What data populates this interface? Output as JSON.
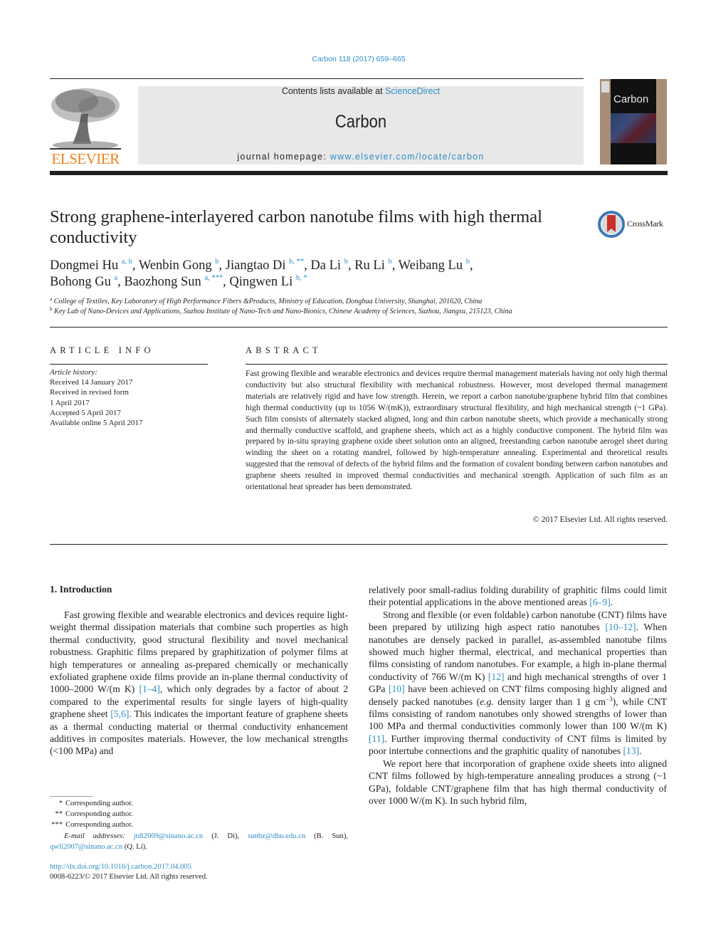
{
  "citation": "Carbon 118 (2017) 659–665",
  "header": {
    "publisher_logo_text": "ELSEVIER",
    "contents_prefix": "Contents lists available at ",
    "contents_link": "ScienceDirect",
    "journal_name": "Carbon",
    "homepage_prefix": "journal homepage: ",
    "homepage_link": "www.elsevier.com/locate/carbon",
    "cover_title": "Carbon"
  },
  "article": {
    "title": "Strong graphene-interlayered carbon nanotube films with high thermal conductivity",
    "crossmark_label": "CrossMark",
    "authors": [
      {
        "name": "Dongmei Hu",
        "marks": "a, b"
      },
      {
        "name": "Wenbin Gong",
        "marks": "b"
      },
      {
        "name": "Jiangtao Di",
        "marks": "b, **"
      },
      {
        "name": "Da Li",
        "marks": "b"
      },
      {
        "name": "Ru Li",
        "marks": "b"
      },
      {
        "name": "Weibang Lu",
        "marks": "b"
      },
      {
        "name": "Bohong Gu",
        "marks": "a"
      },
      {
        "name": "Baozhong Sun",
        "marks": "a, ***"
      },
      {
        "name": "Qingwen Li",
        "marks": "b, *"
      }
    ],
    "affiliations": [
      {
        "mark": "a",
        "text": "College of Textiles, Key Laboratory of High Performance Fibers &Products, Ministry of Education, Donghua University, Shanghai, 201620, China"
      },
      {
        "mark": "b",
        "text": "Key Lab of Nano-Devices and Applications, Suzhou Institute of Nano-Tech and Nano-Bionics, Chinese Academy of Sciences, Suzhou, Jiangsu, 215123, China"
      }
    ]
  },
  "article_info": {
    "heading": "ARTICLE INFO",
    "history_label": "Article history:",
    "history": [
      "Received 14 January 2017",
      "Received in revised form",
      "1 April 2017",
      "Accepted 5 April 2017",
      "Available online 5 April 2017"
    ]
  },
  "abstract": {
    "heading": "ABSTRACT",
    "text": "Fast growing flexible and wearable electronics and devices require thermal management materials having not only high thermal conductivity but also structural flexibility with mechanical robustness. However, most developed thermal management materials are relatively rigid and have low strength. Herein, we report a carbon nanotube/graphene hybrid film that combines high thermal conductivity (up to 1056 W/(mK)), extraordinary structural flexibility, and high mechanical strength (~1 GPa). Such film consists of alternately stacked aligned, long and thin carbon nanotube sheets, which provide a mechanically strong and thermally conductive scaffold, and graphene sheets, which act as a highly conductive component. The hybrid film was prepared by in-situ spraying graphene oxide sheet solution onto an aligned, freestanding carbon nanotube aerogel sheet during winding the sheet on a rotating mandrel, followed by high-temperature annealing. Experimental and theoretical results suggested that the removal of defects of the hybrid films and the formation of covalent bonding between carbon nanotubes and graphene sheets resulted in improved thermal conductivities and mechanical strength. Application of such film as an orientational heat spreader has been demonstrated.",
    "copyright": "© 2017 Elsevier Ltd. All rights reserved."
  },
  "body": {
    "section_heading": "1.  Introduction",
    "left_p1": [
      {
        "t": "Fast growing flexible and wearable electronics and devices require light-weight thermal dissipation materials that combine such properties as high thermal conductivity, good structural flexibility and novel mechanical robustness. Graphitic films prepared by graphitization of polymer films at high temperatures or annealing as-prepared chemically or mechanically exfoliated graphene oxide films provide an in-plane thermal conductivity of 1000–2000 W/(m K) "
      },
      {
        "ref": "[1–4]"
      },
      {
        "t": ", which only degrades by a factor of about 2 compared to the experimental results for single layers of high-quality graphene sheet "
      },
      {
        "ref": "[5,6]"
      },
      {
        "t": ". This indicates the important feature of graphene sheets as a thermal conducting material or thermal conductivity enhancement additives in composites materials. However, the low mechanical strengths (<100 MPa) and"
      }
    ],
    "right_p1": [
      {
        "t": "relatively poor small-radius folding durability of graphitic films could limit their potential applications in the above mentioned areas "
      },
      {
        "ref": "[6–9]"
      },
      {
        "t": "."
      }
    ],
    "right_p2": [
      {
        "t": "Strong and flexible (or even foldable) carbon nanotube (CNT) films have been prepared by utilizing high aspect ratio nanotubes "
      },
      {
        "ref": "[10–12]"
      },
      {
        "t": ". When nanotubes are densely packed in parallel, as-assembled nanotube films showed much higher thermal, electrical, and mechanical properties than films consisting of random nanotubes. For example, a high in-plane thermal conductivity of 766 W/(m K) "
      },
      {
        "ref": "[12]"
      },
      {
        "t": " and high mechanical strengths of over 1 GPa "
      },
      {
        "ref": "[10]"
      },
      {
        "t": " have been achieved on CNT films composing highly aligned and densely packed nanotubes ("
      },
      {
        "i": "e.g."
      },
      {
        "t": " density larger than 1 g cm"
      },
      {
        "sup": "−3"
      },
      {
        "t": "), while CNT films consisting of random nanotubes only showed strengths of lower than 100 MPa and thermal conductivities commonly lower than 100 W/(m K) "
      },
      {
        "ref": "[11]"
      },
      {
        "t": ". Further improving thermal conductivity of CNT films is limited by poor intertube connections and the graphitic quality of nanotubes "
      },
      {
        "ref": "[13]"
      },
      {
        "t": "."
      }
    ],
    "right_p3": [
      {
        "t": "We report here that incorporation of graphene oxide sheets into aligned CNT films followed by high-temperature annealing produces a strong (~1 GPa), foldable CNT/graphene film that has high thermal conductivity of over 1000 W/(m K). In such hybrid film,"
      }
    ]
  },
  "footnotes": {
    "corresponding": [
      {
        "mark": "*",
        "text": "Corresponding author."
      },
      {
        "mark": "**",
        "text": "Corresponding author."
      },
      {
        "mark": "***",
        "text": "Corresponding author."
      }
    ],
    "email_label": "E-mail addresses:",
    "emails": [
      {
        "address": "jtdi2009@sinano.ac.cn",
        "who": "(J. Di)"
      },
      {
        "address": "sunbz@dhu.edu.cn",
        "who": "(B. Sun)"
      },
      {
        "address": "qwli2007@sinano.ac.cn",
        "who": "(Q. Li)"
      }
    ],
    "doi": "http://dx.doi.org/10.1016/j.carbon.2017.04.005",
    "issn": "0008-6223/© 2017 Elsevier Ltd. All rights reserved."
  }
}
